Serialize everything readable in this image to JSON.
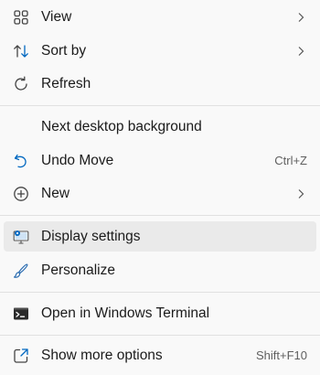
{
  "menu": {
    "items": [
      {
        "label": "View",
        "icon": "grid-icon",
        "submenu": true
      },
      {
        "label": "Sort by",
        "icon": "sort-icon",
        "submenu": true
      },
      {
        "label": "Refresh",
        "icon": "refresh-icon"
      },
      {
        "label": "Next desktop background"
      },
      {
        "label": "Undo Move",
        "icon": "undo-icon",
        "shortcut": "Ctrl+Z"
      },
      {
        "label": "New",
        "icon": "new-icon",
        "submenu": true
      },
      {
        "label": "Display settings",
        "icon": "display-settings-icon",
        "highlighted": true
      },
      {
        "label": "Personalize",
        "icon": "personalize-icon"
      },
      {
        "label": "Open in Windows Terminal",
        "icon": "terminal-icon"
      },
      {
        "label": "Show more options",
        "icon": "show-more-icon",
        "shortcut": "Shift+F10"
      }
    ]
  },
  "colors": {
    "accent": "#0067c0",
    "background": "#f9f9f9",
    "highlight": "#eaeaea",
    "separator": "#e1e1e1"
  }
}
